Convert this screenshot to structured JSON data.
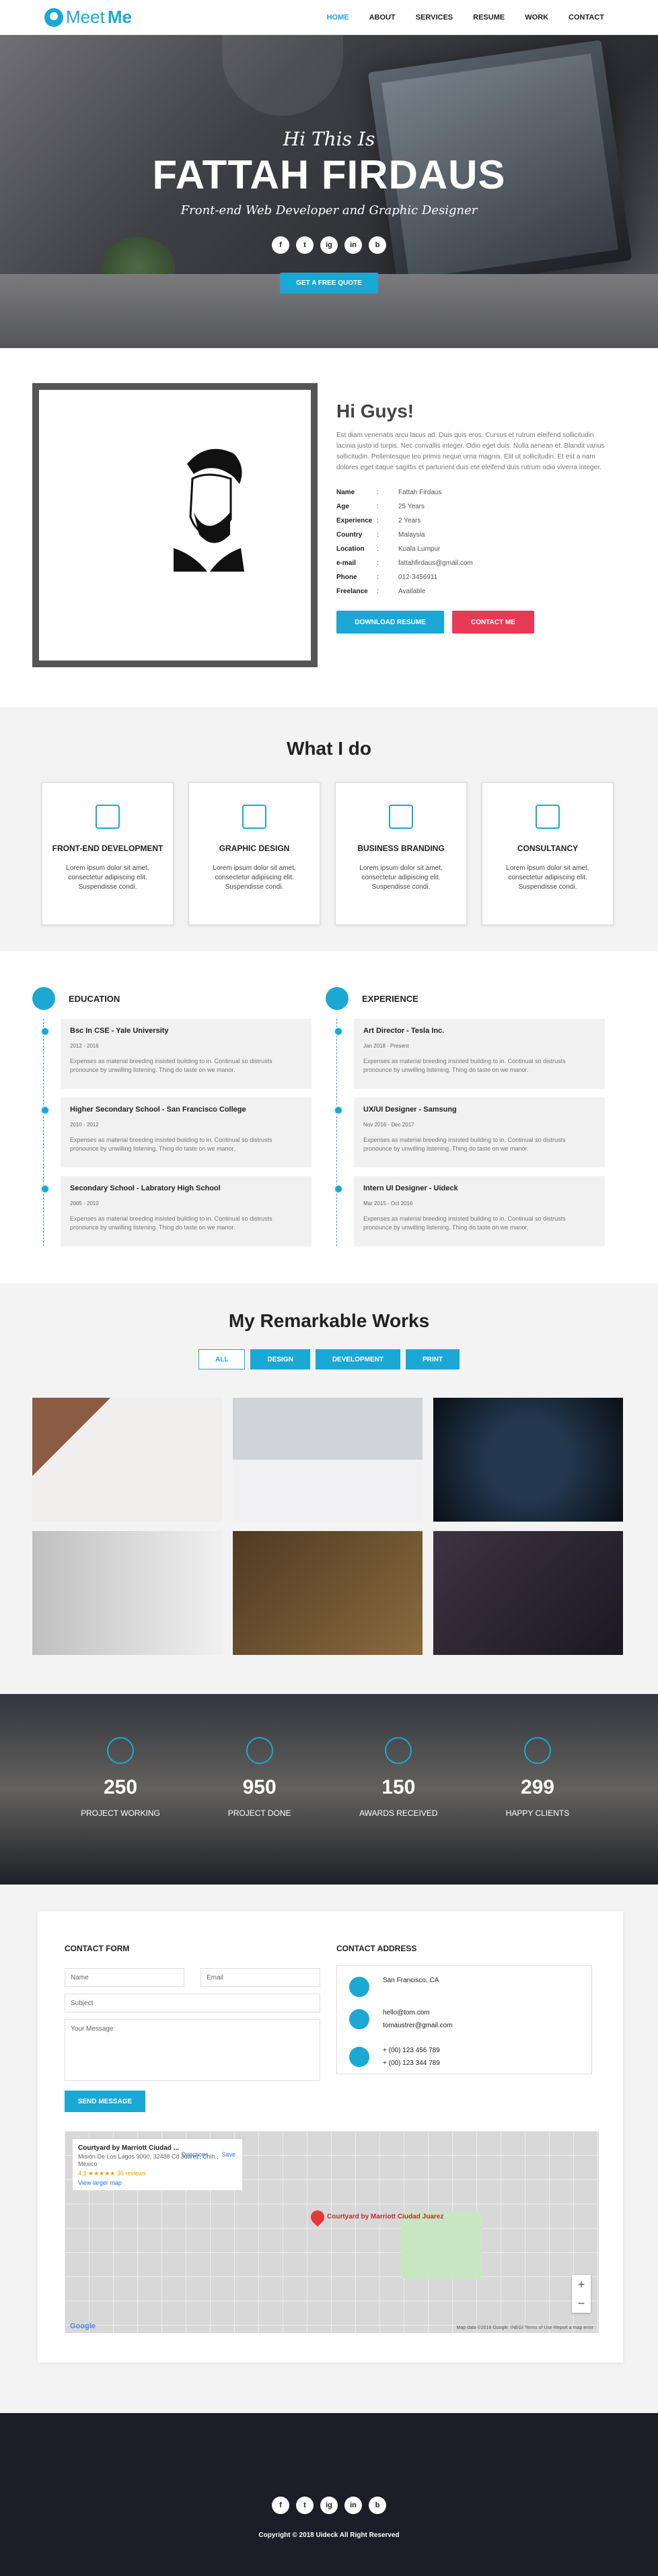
{
  "brand": {
    "name_light": "Meet",
    "name_bold": "Me"
  },
  "nav": {
    "items": [
      "HOME",
      "ABOUT",
      "SERVICES",
      "RESUME",
      "WORK",
      "CONTACT"
    ]
  },
  "hero": {
    "greeting": "Hi This Is",
    "name": "FATTAH FIRDAUS",
    "role": "Front-end Web Developer and Graphic Designer",
    "cta": "GET A FREE QUOTE",
    "social": [
      "f",
      "t",
      "ig",
      "in",
      "b"
    ]
  },
  "about": {
    "title": "Hi Guys!",
    "paragraph": "Est diam venenatis arcu lacus ad. Duis quis eros. Cursus et rutrum eleifend sollicitudin lacinia justo id turpis. Nec convallis integer. Odio eget duis. Nulla aenean et. Blandit varius sollicitudin. Pellentesque leo primis neque urna magnis. Elit ut sollicitudin. Et est a nam dolores eget itaque sagittis et parturient duis ete eleifend duis rutrum odio viverra integer.",
    "details": [
      {
        "key": "Name",
        "value": "Fattah Firdaus"
      },
      {
        "key": "Age",
        "value": "25 Years"
      },
      {
        "key": "Experience",
        "value": "2 Years"
      },
      {
        "key": "Country",
        "value": "Malaysia"
      },
      {
        "key": "Location",
        "value": "Kuala Lumpur"
      },
      {
        "key": "e-mail",
        "value": "fattahfirdaus@gmail.com"
      },
      {
        "key": "Phone",
        "value": "012-3456911"
      },
      {
        "key": "Freelance",
        "value": "Available"
      }
    ],
    "download": "DOWNLOAD RESUME",
    "contact": "CONTACT ME"
  },
  "services": {
    "title": "What I do",
    "items": [
      {
        "title": "FRONT-END DEVELOPMENT",
        "text": "Lorem ipsum dolor sit amet, consectetur adipiscing elit. Suspendisse condi."
      },
      {
        "title": "GRAPHIC DESIGN",
        "text": "Lorem ipsum dolor sit amet, consectetur adipiscing elit. Suspendisse condi."
      },
      {
        "title": "BUSINESS BRANDING",
        "text": "Lorem ipsum dolor sit amet, consectetur adipiscing elit. Suspendisse condi."
      },
      {
        "title": "CONSULTANCY",
        "text": "Lorem ipsum dolor sit amet, consectetur adipiscing elit. Suspendisse condi."
      }
    ]
  },
  "resume": {
    "education": {
      "title": "EDUCATION",
      "items": [
        {
          "title": "Bsc In CSE - Yale University",
          "date": "2012 - 2016",
          "text": "Expenses as material breeding insisted building to in. Continual so distrusts pronounce by unwilling listening. Thing do taste on we manor."
        },
        {
          "title": "Higher Secondary School - San Francisco College",
          "date": "2010 - 2012",
          "text": "Expenses as material breeding insisted building to in. Continual so distrusts pronounce by unwilling listening. Thing do taste on we manor."
        },
        {
          "title": "Secondary School - Labratory High School",
          "date": "2005 - 2010",
          "text": "Expenses as material breeding insisted building to in. Continual so distrusts pronounce by unwilling listening. Thing do taste on we manor."
        }
      ]
    },
    "experience": {
      "title": "EXPERIENCE",
      "items": [
        {
          "title": "Art Director - Tesla Inc.",
          "date": "Jan 2018 - Present",
          "text": "Expenses as material breeding insisted building to in. Continual so distrusts pronounce by unwilling listening. Thing do taste on we manor."
        },
        {
          "title": "UX/UI Designer - Samsung",
          "date": "Nov 2016 - Dec 2017",
          "text": "Expenses as material breeding insisted building to in. Continual so distrusts pronounce by unwilling listening. Thing do taste on we manor."
        },
        {
          "title": "Intern UI Designer - Uideck",
          "date": "Mar 2015 - Oct 2016",
          "text": "Expenses as material breeding insisted building to in. Continual so distrusts pronounce by unwilling listening. Thing do taste on we manor."
        }
      ]
    }
  },
  "works": {
    "title": "My Remarkable Works",
    "filters": [
      "ALL",
      "DESIGN",
      "DEVELOPMENT",
      "PRINT"
    ]
  },
  "stats": [
    {
      "value": "250",
      "label": "PROJECT WORKING"
    },
    {
      "value": "950",
      "label": "PROJECT DONE"
    },
    {
      "value": "150",
      "label": "AWARDS RECEIVED"
    },
    {
      "value": "299",
      "label": "HAPPY CLIENTS"
    }
  ],
  "contact": {
    "form_title": "CONTACT FORM",
    "name_placeholder": "Name",
    "email_placeholder": "Email",
    "subject_placeholder": "Subject",
    "message_placeholder": "Your Message",
    "send": "SEND MESSAGE",
    "address_title": "CONTACT ADDRESS",
    "location": "San Francisco, CA",
    "emails": [
      "hello@tom.com",
      "tomaustrer@gmail.com"
    ],
    "phones": [
      "+ (00) 123 456 789",
      "+ (00) 123 344 789"
    ]
  },
  "map": {
    "place": "Courtyard by Marriott Ciudad ...",
    "address": "Misión De Los Lagos 9000, 32488 Cd Juárez, Chih., Mexico",
    "rating": "4.3 ★★★★★ 36 reviews",
    "larger": "View larger map",
    "directions": "Directions",
    "save": "Save",
    "pin_label": "Courtyard by Marriott Ciudad Juarez",
    "footer": "Map data ©2018 Google, INEGI   Terms of Use   Report a map error",
    "logo": "Google"
  },
  "footer": {
    "copyright": "Copyright © 2018 Uideck All Right Reserved",
    "social": [
      "f",
      "t",
      "ig",
      "in",
      "b"
    ]
  }
}
